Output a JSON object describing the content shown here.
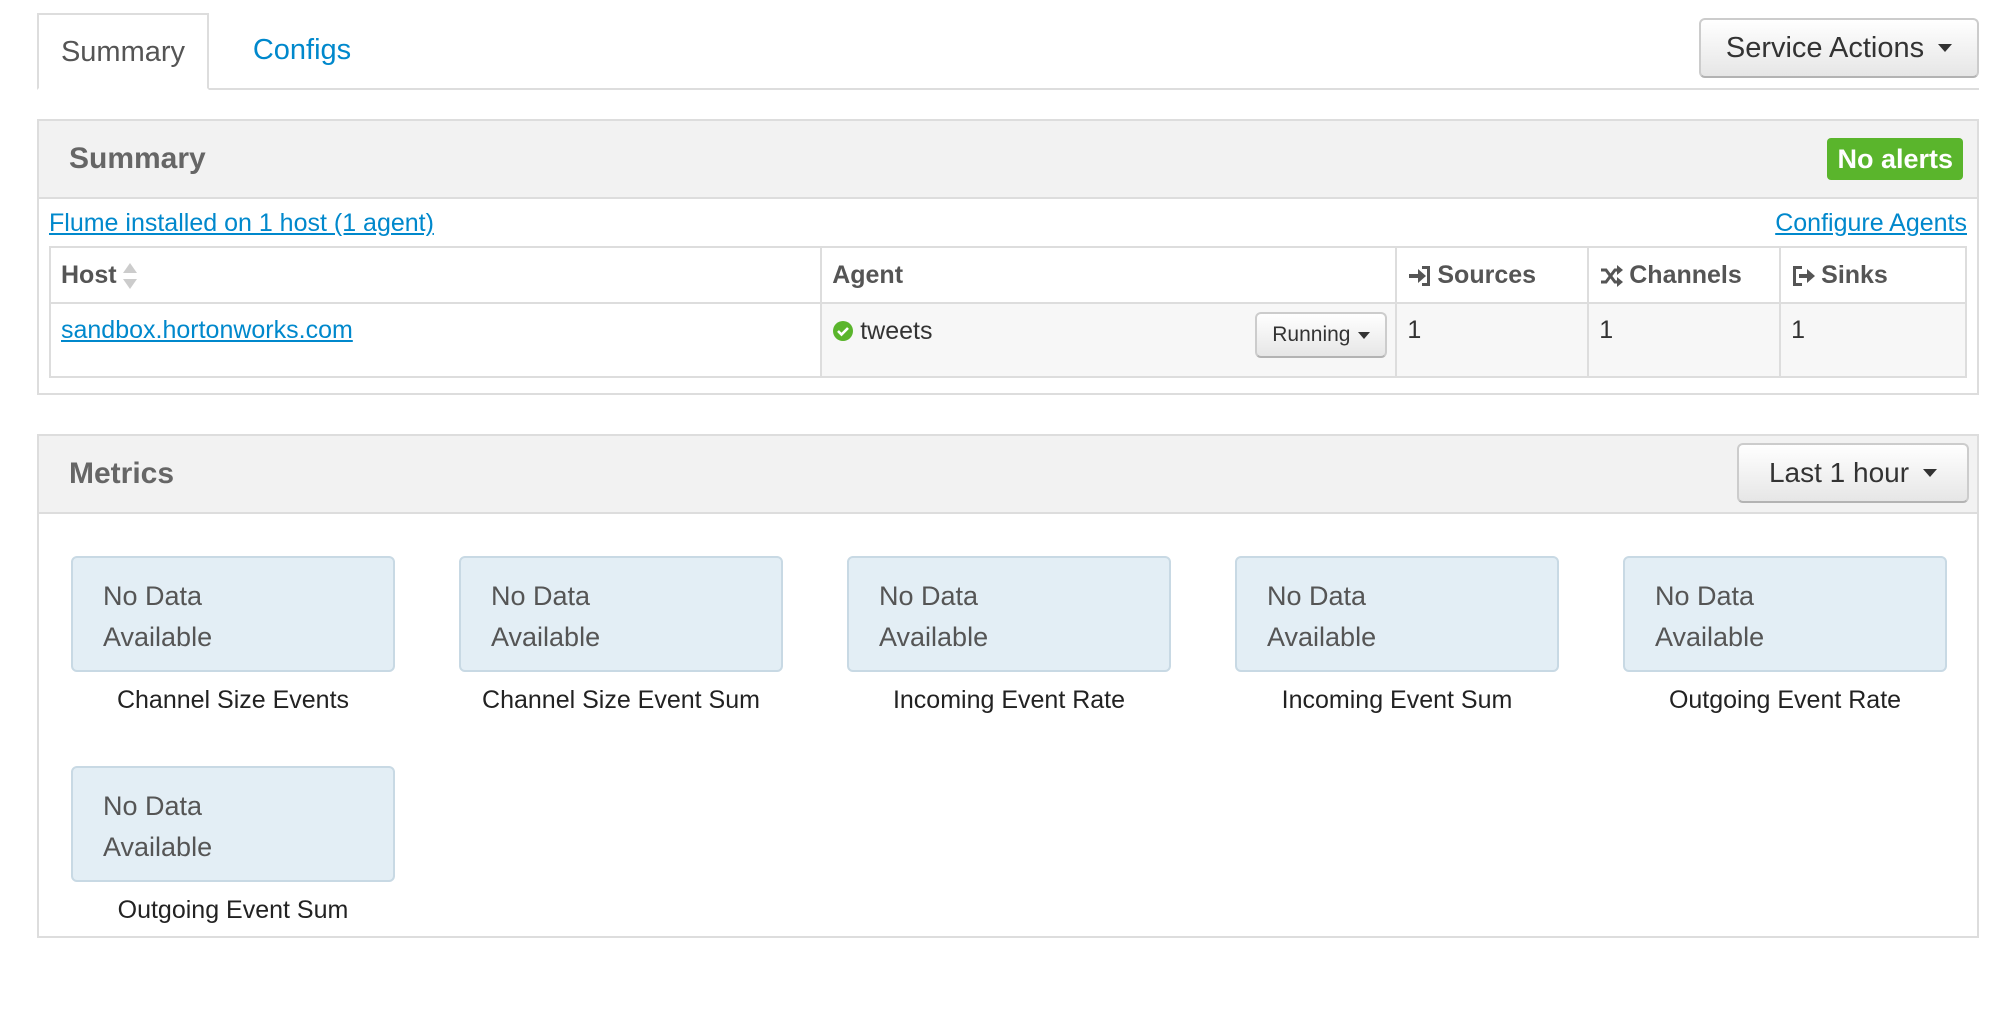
{
  "tabs": [
    {
      "label": "Summary",
      "active": true
    },
    {
      "label": "Configs",
      "active": false
    }
  ],
  "service_actions_label": "Service Actions",
  "summary_panel": {
    "title": "Summary",
    "alert_badge": "No alerts",
    "install_link": "Flume installed on 1 host (1 agent)",
    "configure_link": "Configure Agents",
    "table": {
      "headers": {
        "host": "Host",
        "agent": "Agent",
        "sources": "Sources",
        "channels": "Channels",
        "sinks": "Sinks"
      },
      "rows": [
        {
          "host": "sandbox.hortonworks.com",
          "agent": "tweets",
          "status": "Running",
          "sources": "1",
          "channels": "1",
          "sinks": "1"
        }
      ]
    }
  },
  "metrics_panel": {
    "title": "Metrics",
    "range_label": "Last 1 hour",
    "no_data_line1": "No Data",
    "no_data_line2": "Available",
    "metrics": [
      {
        "label": "Channel Size Events"
      },
      {
        "label": "Channel Size Event Sum"
      },
      {
        "label": "Incoming Event Rate"
      },
      {
        "label": "Incoming Event Sum"
      },
      {
        "label": "Outgoing Event Rate"
      },
      {
        "label": "Outgoing Event Sum"
      }
    ]
  },
  "colors": {
    "link": "#0088cc",
    "alert_badge_bg": "#5ab52c",
    "status_ok": "#5ab52c",
    "metric_box_bg": "#e3eef5"
  },
  "icons": {
    "sort": "sort-icon",
    "sources": "sign-in-icon",
    "channels": "random-icon",
    "sinks": "sign-out-icon",
    "status": "check-circle-icon"
  }
}
